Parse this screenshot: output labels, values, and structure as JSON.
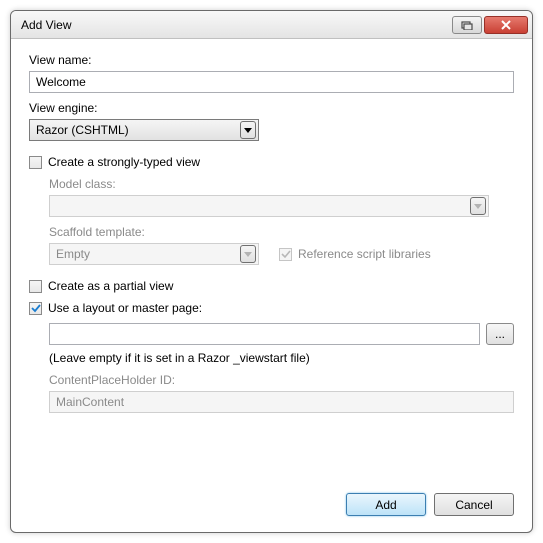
{
  "window": {
    "title": "Add View"
  },
  "form": {
    "view_name_label": "View name:",
    "view_name_value": "Welcome",
    "view_engine_label": "View engine:",
    "view_engine_value": "Razor (CSHTML)",
    "strongly_typed_label": "Create a strongly-typed view",
    "model_class_label": "Model class:",
    "model_class_value": "",
    "scaffold_template_label": "Scaffold template:",
    "scaffold_template_value": "Empty",
    "reference_script_label": "Reference script libraries",
    "partial_view_label": "Create as a partial view",
    "use_layout_label": "Use a layout or master page:",
    "layout_value": "",
    "layout_hint": "(Leave empty if it is set in a Razor _viewstart file)",
    "cph_label": "ContentPlaceHolder ID:",
    "cph_value": "MainContent",
    "browse_label": "..."
  },
  "buttons": {
    "add": "Add",
    "cancel": "Cancel"
  }
}
